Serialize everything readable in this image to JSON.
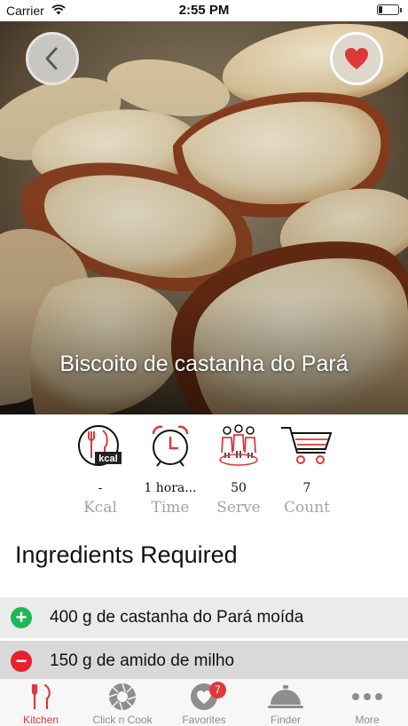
{
  "status_bar": {
    "carrier": "Carrier",
    "time": "2:55 PM"
  },
  "recipe": {
    "title": "Biscoito de castanha do Pará"
  },
  "stats": [
    {
      "icon": "kcal-icon",
      "value": "-",
      "label": "Kcal"
    },
    {
      "icon": "alarm-clock-icon",
      "value": "1 hora...",
      "label": "Time"
    },
    {
      "icon": "people-icon",
      "value": "50",
      "label": "Serve"
    },
    {
      "icon": "shopping-cart-icon",
      "value": "7",
      "label": "Count"
    }
  ],
  "kcal_badge": "kcal",
  "ingredients_heading": "Ingredients Required",
  "ingredients": [
    {
      "action": "add",
      "text": "400 g de castanha do Pará moída"
    },
    {
      "action": "remove",
      "text": "150 g de amido de milho"
    }
  ],
  "tabs": [
    {
      "label": "Kitchen",
      "icon": "fork-knife-icon",
      "active": true
    },
    {
      "label": "Click n Cook",
      "icon": "camera-shutter-icon",
      "active": false
    },
    {
      "label": "Favorites",
      "icon": "heart-icon",
      "active": false,
      "badge": "7"
    },
    {
      "label": "Finder",
      "icon": "cloche-icon",
      "active": false
    },
    {
      "label": "More",
      "icon": "more-dots-icon",
      "active": false
    }
  ],
  "colors": {
    "accent": "#e0383a",
    "add": "#1db954",
    "remove": "#e8202e",
    "row_add_bg": "#ebebeb",
    "row_remove_bg": "#d9d9d9"
  }
}
